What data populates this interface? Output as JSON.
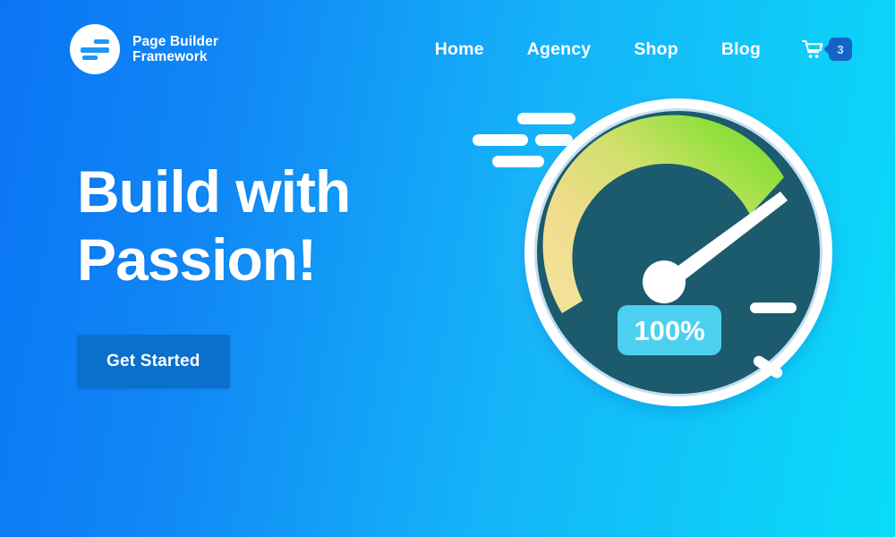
{
  "brand": {
    "logo_icon": "page-builder-logo-icon",
    "name_line1": "Page Builder",
    "name_line2": "Framework"
  },
  "nav": {
    "items": [
      {
        "label": "Home"
      },
      {
        "label": "Agency"
      },
      {
        "label": "Shop"
      },
      {
        "label": "Blog"
      }
    ],
    "cart": {
      "icon": "shopping-cart-icon",
      "badge_count": "3"
    }
  },
  "hero": {
    "headline_line1": "Build with",
    "headline_line2": "Passion!",
    "cta_label": "Get Started"
  },
  "illustration": {
    "name": "speedometer-gauge-illustration",
    "score_label": "100%",
    "speed_lines": "speed-lines-icon",
    "needle": "gauge-needle-icon"
  },
  "colors": {
    "bg_gradient_start": "#0b74f5",
    "bg_gradient_end": "#09dcf8",
    "cta_blue": "#0b6fcc",
    "badge_blue": "#1464c8",
    "gauge_face": "#1a5a6e",
    "gauge_ring": "#ffffff",
    "arc_yellow": "#f0dc8c",
    "arc_green": "#6edc28",
    "score_badge": "#4dd0f0"
  }
}
